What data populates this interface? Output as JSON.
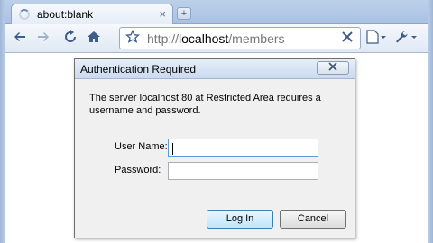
{
  "browser": {
    "tab_title": "about:blank",
    "new_tab_symbol": "+",
    "tab_close_symbol": "×",
    "url_scheme": "http://",
    "url_host": "localhost",
    "url_path": "/members",
    "icons": {
      "back": "back-arrow-icon",
      "forward": "forward-arrow-icon",
      "reload": "reload-icon",
      "home": "home-icon",
      "bookmark": "star-icon",
      "stop": "stop-icon",
      "page_menu": "page-menu-icon",
      "tools_menu": "wrench-icon"
    }
  },
  "dialog": {
    "title": "Authentication Required",
    "message": "The server localhost:80 at Restricted Area requires a username and password.",
    "username_label": "User Name:",
    "username_value": "",
    "password_label": "Password:",
    "password_value": "",
    "login_button": "Log In",
    "cancel_button": "Cancel"
  },
  "colors": {
    "frame": "#bcd0ea",
    "toolbar_icon": "#3e5d8a",
    "dialog_bg": "#f0f0f0",
    "default_button": "#bee6fd"
  }
}
